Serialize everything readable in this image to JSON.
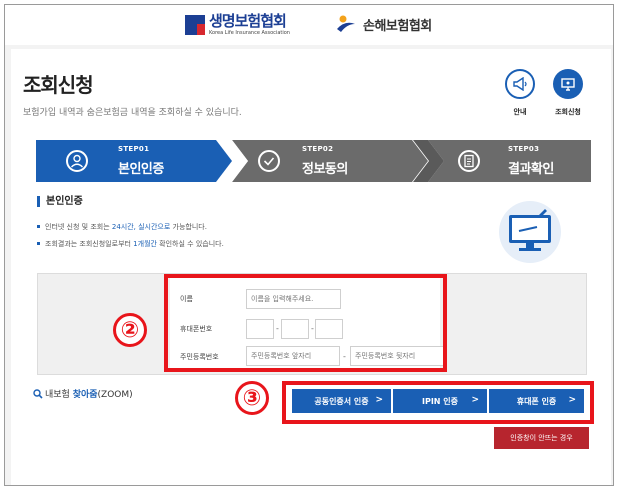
{
  "header": {
    "logo_life_main": "생명보험협회",
    "logo_life_sub": "Korea Life Insurance Association",
    "logo_nonlife_main": "손해보험협회"
  },
  "page": {
    "title": "조회신청",
    "description": "보험가입 내역과 숨은보험금 내역을 조회하실 수 있습니다."
  },
  "quick_links": [
    {
      "label": "안내",
      "icon": "megaphone-icon",
      "color": "#1a5fb4"
    },
    {
      "label": "조회신청",
      "icon": "monitor-icon",
      "color": "#1a5fb4"
    }
  ],
  "steps": [
    {
      "small": "STEP01",
      "big": "본인인증",
      "active": true
    },
    {
      "small": "STEP02",
      "big": "정보동의",
      "active": false
    },
    {
      "small": "STEP03",
      "big": "결과확인",
      "active": false
    }
  ],
  "section": {
    "title": "본인인증",
    "bullet1_pre": "인터넷 신청 및 조회는 ",
    "bullet1_hl": "24시간, 실시간으로",
    "bullet1_post": " 가능합니다.",
    "bullet2_pre": "조회결과는 조회신청일로부터 ",
    "bullet2_hl": "1개월간",
    "bullet2_post": " 확인하실 수 있습니다."
  },
  "form": {
    "name_label": "이름",
    "name_placeholder": "이름을 입력해주세요.",
    "phone_label": "휴대폰번호",
    "phone_dash": "-",
    "rrn_label": "주민등록번호",
    "rrn_front_placeholder": "주민등록번호 앞자리",
    "rrn_back_placeholder": "주민등록번호 뒷자리",
    "rrn_dash": "-"
  },
  "annotations": {
    "marker2": "②",
    "marker3": "③"
  },
  "zoom": {
    "pre": "내보험 ",
    "strong": "찾아줌",
    "post": "(ZOOM)"
  },
  "auth_buttons": {
    "cert": "공동인증서 인증",
    "ipin": "IPIN 인증",
    "phone": "휴대폰 인증",
    "chevron": ">"
  },
  "fail_button": "인증창이 안뜨는 경우",
  "colors": {
    "accent": "#1a5fb4",
    "step_inactive": "#6b6b6b",
    "annotation_red": "#e8151b",
    "fail_button": "#b7252e"
  }
}
